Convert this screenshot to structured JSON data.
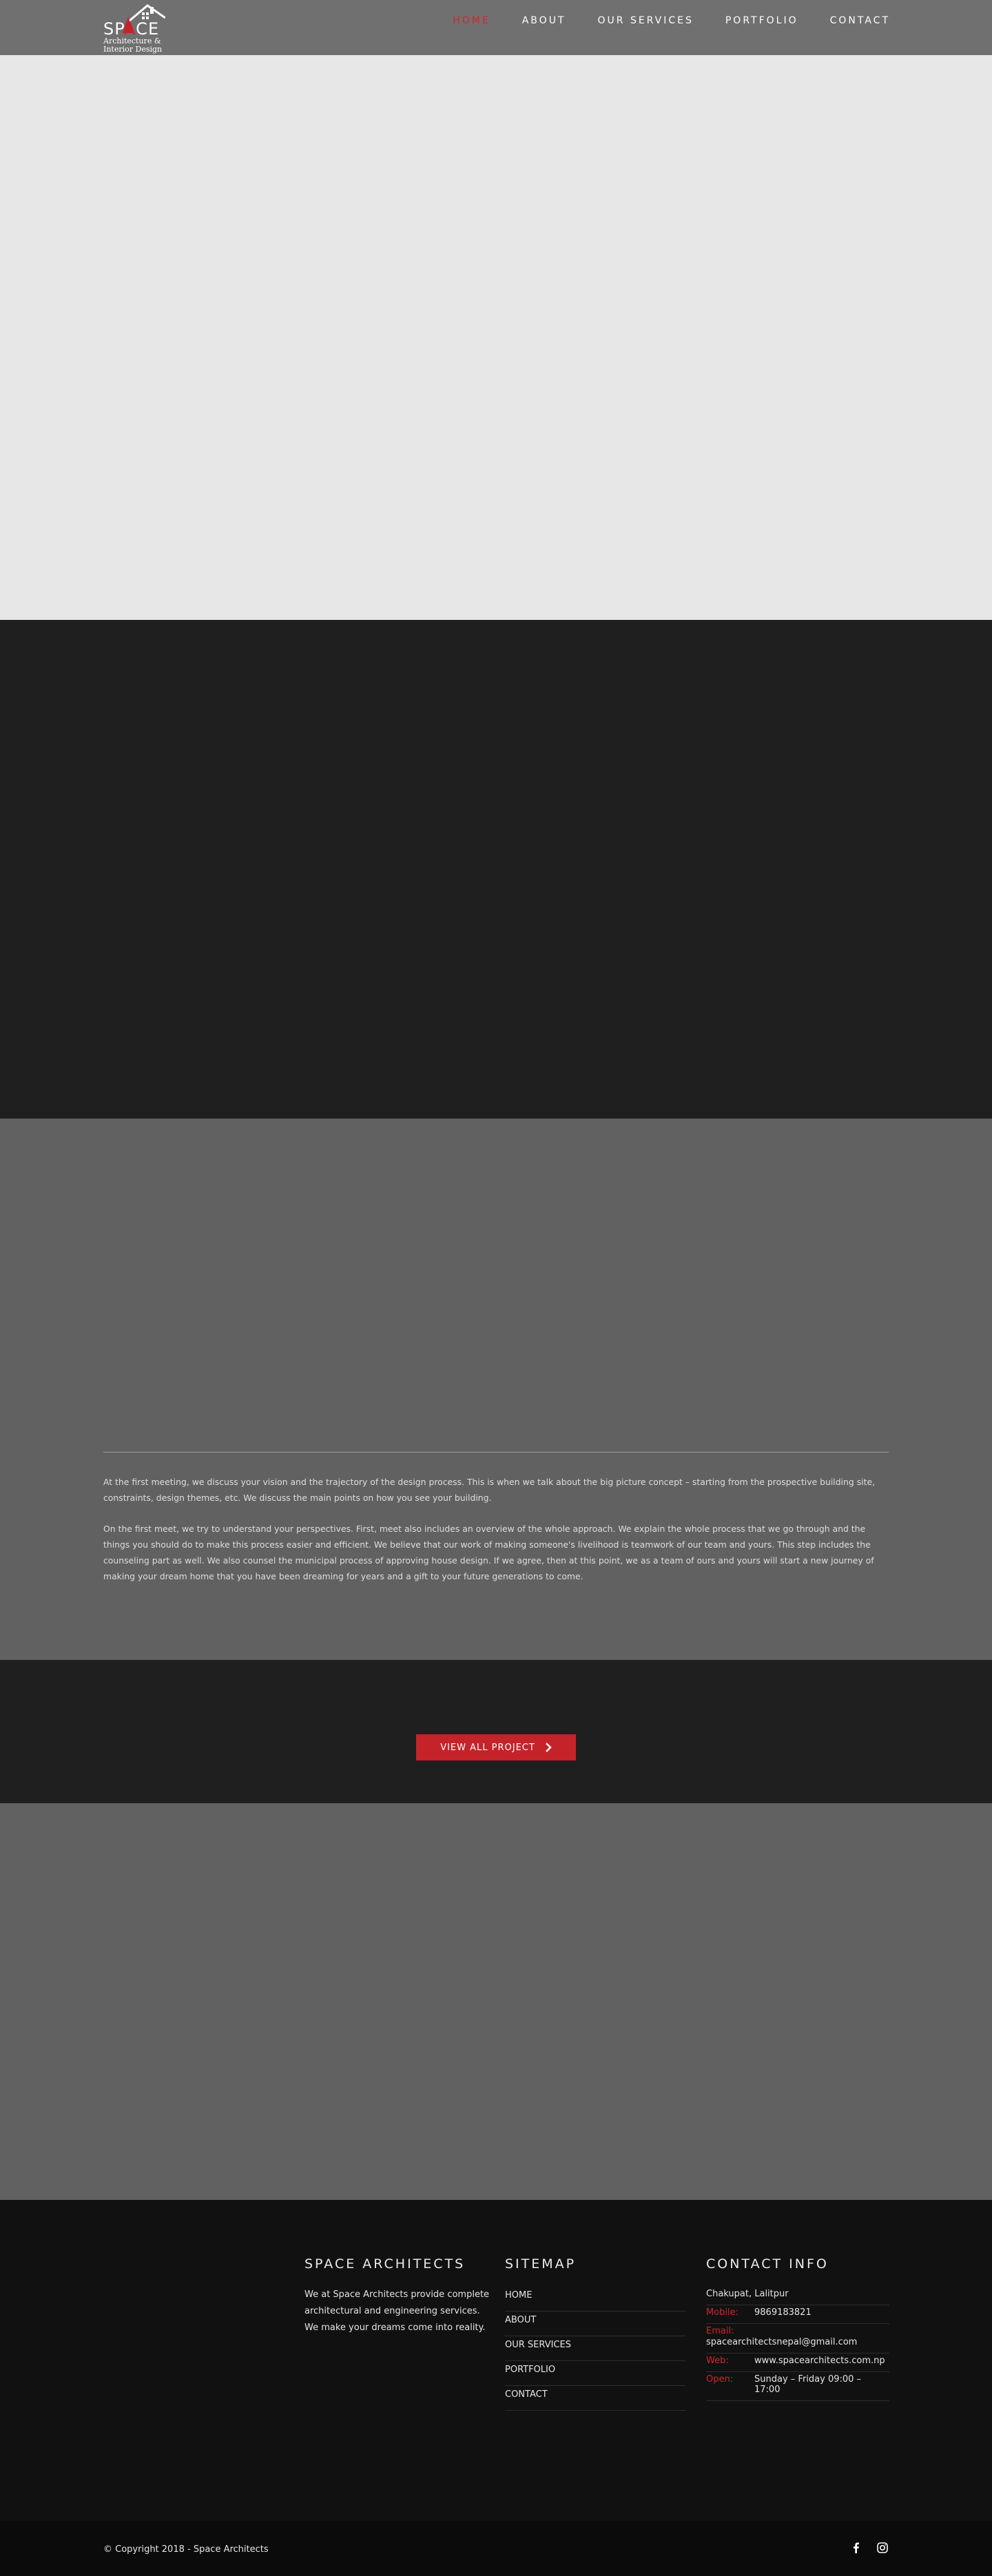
{
  "header": {
    "logo": {
      "wordmark": "SPACE",
      "tagline_line1": "Architecture &",
      "tagline_line2": "Interior Design"
    },
    "nav": [
      {
        "label": "HOME",
        "active": true
      },
      {
        "label": "ABOUT",
        "active": false
      },
      {
        "label": "OUR SERVICES",
        "active": false
      },
      {
        "label": "PORTFOLIO",
        "active": false
      },
      {
        "label": "CONTACT",
        "active": false
      }
    ]
  },
  "process": {
    "paragraph1": "At the first meeting, we discuss your vision and the trajectory of the design process. This is when we talk about the big picture concept – starting from the prospective building site, constraints, design themes, etc. We discuss the main points on how you see your building.",
    "paragraph2": "On the first meet, we try to understand your perspectives. First, meet also includes an overview of the whole approach. We explain the whole process that we go through and the things you should do to make this process easier and efficient. We believe that our work of making someone's livelihood is teamwork of our team and yours. This step includes the counseling part as well. We also counsel the municipal process of approving house design. If we agree, then at this point, we as a team of ours and yours will start a new journey of making your dream home that you have been dreaming for years and a gift to your future generations to come."
  },
  "cta": {
    "label": "VIEW ALL PROJECT"
  },
  "footer": {
    "about": {
      "heading": "SPACE ARCHITECTS",
      "text": "We at Space Architects provide complete architectural and engineering services. We make your dreams come into reality."
    },
    "sitemap": {
      "heading": "SITEMAP",
      "links": [
        "HOME",
        "ABOUT",
        "OUR SERVICES",
        "PORTFOLIO",
        "CONTACT"
      ]
    },
    "contact": {
      "heading": "CONTACT INFO",
      "address": "Chakupat, Lalitpur",
      "mobile_label": "Mobile:",
      "mobile_value": "9869183821",
      "email_label": "Email:",
      "email_value": "spacearchitectsnepal@gmail.com",
      "web_label": "Web:",
      "web_value": "www.spacearchitects.com.np",
      "open_label": "Open:",
      "open_value": "Sunday – Friday 09:00 – 17:00"
    }
  },
  "bottom": {
    "copyright": "© Copyright 2018 - Space Architects",
    "social_icons": [
      "facebook-icon",
      "instagram-icon"
    ]
  },
  "colors": {
    "accent": "#c4232a",
    "header_bg": "#707070",
    "hero_bg": "#e7e7e7",
    "dark_bg": "#1f1f1f",
    "grey_bg": "#616161",
    "footer_bg": "#111111"
  }
}
